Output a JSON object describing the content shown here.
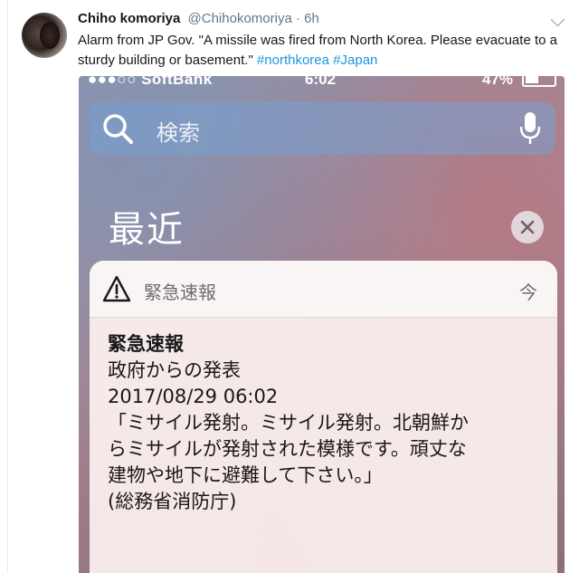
{
  "tweet": {
    "author_name": "Chiho komoriya",
    "author_handle": "@Chihokomoriya",
    "time": " · 6h",
    "text_plain": "Alarm from JP Gov. \"A missile was fired from North Korea. Please evacuate to a sturdy building or basement.\" ",
    "hashtags": [
      "#northkorea",
      "#Japan"
    ]
  },
  "phone": {
    "status_bar": {
      "carrier": "●●●○○ SoftBank",
      "time": "6:02",
      "battery": "47%"
    },
    "search": {
      "placeholder": "検索"
    },
    "section_title": "最近",
    "notification": {
      "app_label": "緊急速報",
      "time_label": "今",
      "title": "緊急速報",
      "source": "政府からの発表",
      "datetime": "2017/08/29 06:02",
      "message_lines": [
        "「ミサイル発射。ミサイル発射。北朝鮮か",
        "らミサイルが発射された模様です。頑丈な",
        "建物や地下に避難して下さい。」"
      ],
      "agency": "(総務省消防庁)"
    }
  }
}
